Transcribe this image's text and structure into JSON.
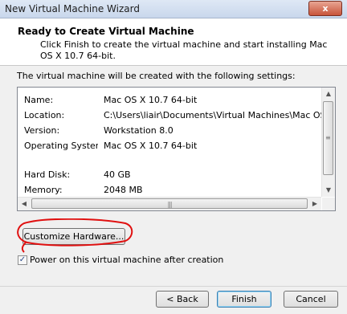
{
  "window": {
    "title": "New Virtual Machine Wizard",
    "close_label": "x"
  },
  "header": {
    "title": "Ready to Create Virtual Machine",
    "subtitle": "Click Finish to create the virtual machine and start installing Mac OS X 10.7 64-bit."
  },
  "intro_text": "The virtual machine will be created with the following settings:",
  "settings": [
    {
      "key": "Name:",
      "value": "Mac OS X 10.7 64-bit"
    },
    {
      "key": "Location:",
      "value": "C:\\Users\\liair\\Documents\\Virtual Machines\\Mac OS"
    },
    {
      "key": "Version:",
      "value": "Workstation 8.0"
    },
    {
      "key": "Operating System:",
      "value": "Mac OS X 10.7 64-bit"
    },
    {
      "key": "Hard Disk:",
      "value": "40 GB"
    },
    {
      "key": "Memory:",
      "value": "2048 MB"
    }
  ],
  "customize_button": "Customize Hardware...",
  "power_on": {
    "label": "Power on this virtual machine after creation",
    "checked": true
  },
  "buttons": {
    "back": "< Back",
    "finish": "Finish",
    "cancel": "Cancel"
  },
  "colors": {
    "annotation": "#e01010"
  }
}
